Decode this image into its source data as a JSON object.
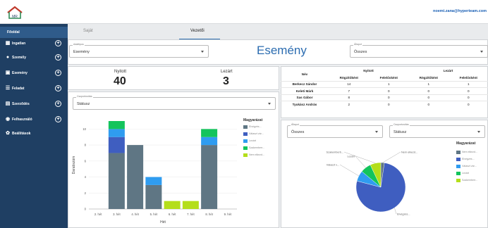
{
  "header": {
    "logo_text": "MR",
    "user_email": "noemi.zana@hyperteam.com"
  },
  "sidebar": {
    "items": [
      {
        "label": "Főoldal",
        "icon": "home-icon"
      },
      {
        "label": "Ingatlan",
        "icon": "building-icon"
      },
      {
        "label": "Személy",
        "icon": "person-icon"
      },
      {
        "label": "Esemény",
        "icon": "calendar-icon"
      },
      {
        "label": "Feladat",
        "icon": "list-icon"
      },
      {
        "label": "Szerződés",
        "icon": "contract-icon"
      },
      {
        "label": "Felhasználó",
        "icon": "user-icon"
      },
      {
        "label": "Beállítások",
        "icon": "gear-icon"
      }
    ]
  },
  "tabs": [
    {
      "label": "Saját"
    },
    {
      "label": "Vezetői"
    }
  ],
  "filters": {
    "adattipus": {
      "caption": "Adattípus",
      "value": "Esemény"
    },
    "allapot": {
      "caption": "Állapot",
      "value": "Összes"
    },
    "title": "Esemény"
  },
  "counters": {
    "nyitott_label": "Nyitott",
    "nyitott_value": "40",
    "lezart_label": "Lezárt",
    "lezart_value": "3"
  },
  "bar_group": {
    "caption": "Csoportosítás",
    "value": "Státusz"
  },
  "people_table": {
    "name_header": "Név",
    "group_open": "Nyitott",
    "group_closed": "Lezárt",
    "sub": [
      "Rögzítőként",
      "Felelősként",
      "Rögzítőként",
      "Felelősként"
    ],
    "rows": [
      {
        "name": "Berkecz Sándor",
        "values": [
          "14",
          "1",
          "1",
          "1"
        ]
      },
      {
        "name": "Keleti Márk",
        "values": [
          "7",
          "0",
          "0",
          "0"
        ]
      },
      {
        "name": "Sas Gábor",
        "values": [
          "8",
          "0",
          "0",
          "0"
        ]
      },
      {
        "name": "Tyukász András",
        "values": [
          "2",
          "0",
          "0",
          "0"
        ]
      }
    ]
  },
  "pie_filters": {
    "allapot": {
      "caption": "Állapot",
      "value": "Összes"
    },
    "group": {
      "caption": "Csoportosítás",
      "value": "Státusz"
    }
  },
  "colors": {
    "bar_dark": "#5f7684",
    "bar_blue": "#3f5ec0",
    "bar_light_blue": "#2f9cf0",
    "bar_green": "#13c45c",
    "bar_lime": "#b4de1a",
    "accent": "#2b6cb0",
    "sidebar": "#1f3f63"
  },
  "chart_data": [
    {
      "type": "bar",
      "stacked": true,
      "categories": [
        "2. hét",
        "3. hét",
        "4. hét",
        "5. hét",
        "6. hét",
        "7. hét",
        "8. hét",
        "9. hét"
      ],
      "series": [
        {
          "name": "Elvégzés...",
          "values": [
            0,
            7,
            8,
            3,
            0,
            0,
            8,
            0
          ]
        },
        {
          "name": "Választ vár...",
          "values": [
            0,
            2,
            0,
            0,
            0,
            0,
            0,
            0
          ]
        },
        {
          "name": "Lezárt",
          "values": [
            0,
            1,
            0,
            1,
            0,
            0,
            1,
            0
          ]
        },
        {
          "name": "Szakemberr...",
          "values": [
            0,
            1,
            0,
            0,
            0,
            0,
            1,
            0
          ]
        },
        {
          "name": "Nem elkezd...",
          "values": [
            0,
            0,
            0,
            0,
            1,
            1,
            0,
            0
          ]
        }
      ],
      "ylabel": "Darabszám",
      "xlabel": "Hét",
      "ylim": [
        0,
        11
      ],
      "yticks": [
        "0",
        "2",
        "4",
        "6",
        "8",
        "10"
      ],
      "legend_title": "Magyarázat",
      "legend_position": "right"
    },
    {
      "type": "pie",
      "labels": [
        "Nem elkezd...",
        "Elvégzés...",
        "Választ vár...",
        "Lezárt",
        "Szakemberr..."
      ],
      "values": [
        1,
        33,
        3,
        3,
        3
      ],
      "legend_title": "Magyarázat",
      "legend_labels": [
        "Nem elkezd...",
        "Elvégzés...",
        "Választ vár...",
        "Lezárt",
        "Szakemberr..."
      ],
      "slice_labels": [
        "Nem elkezd...",
        "Elvégzés...",
        "Választ v...",
        "Lezárt",
        "Szakemberb..."
      ],
      "legend_position": "right"
    }
  ]
}
